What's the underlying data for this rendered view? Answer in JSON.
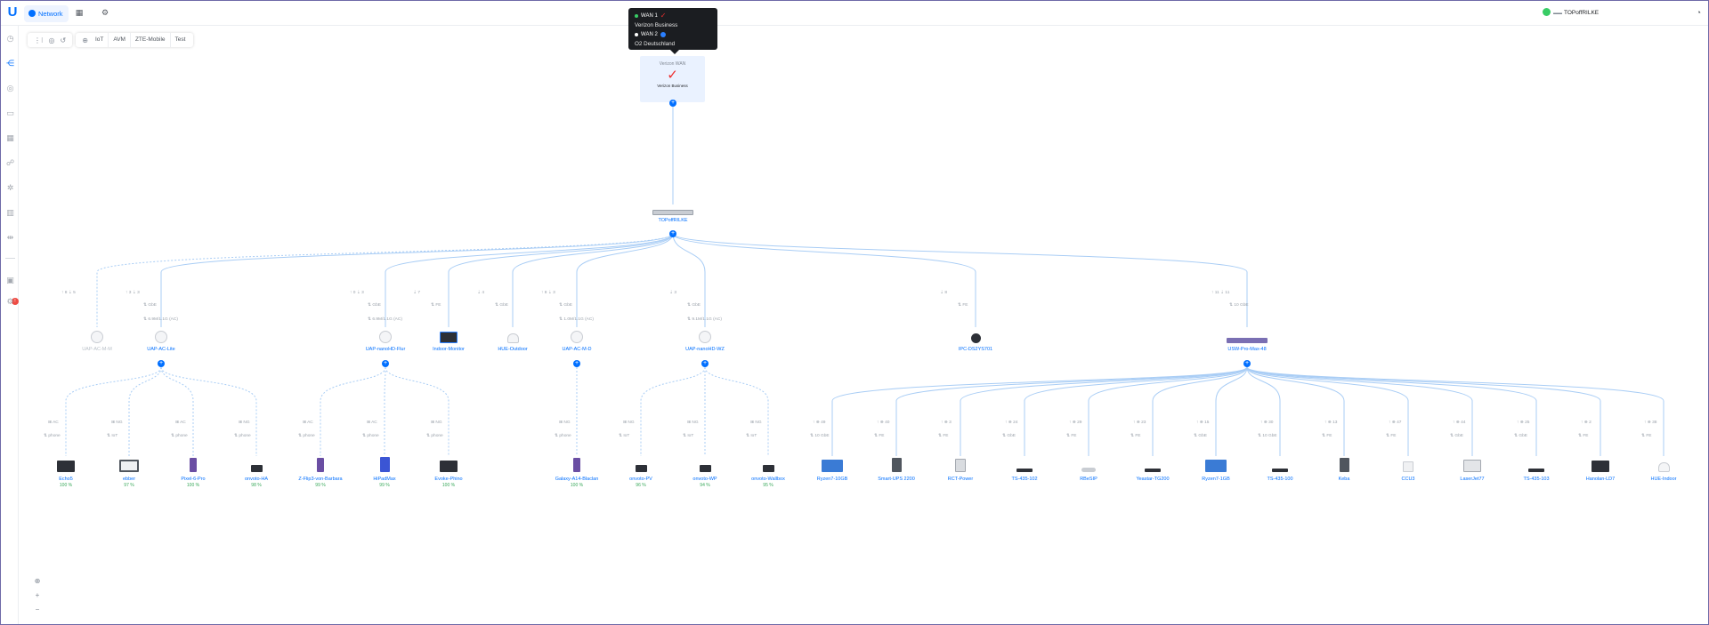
{
  "app": {
    "active_tab": "Network",
    "console_name": "TOPoffRILKE"
  },
  "colors": {
    "accent": "#006fff",
    "online": "#38cc65",
    "alert": "#ee4b43",
    "link": "#a9cdf5",
    "verizon": "#ee2d2d"
  },
  "toolbar": {
    "filters": [
      "IoT",
      "AVM",
      "ZTE-Mobile",
      "Test"
    ]
  },
  "wan_tooltip": {
    "rows": [
      {
        "name": "WAN 1",
        "isp": "Verizon Business",
        "status_color": "#38cc65"
      },
      {
        "name": "WAN 2",
        "isp": "O2 Deutschland",
        "status_color": "#ffffff"
      }
    ]
  },
  "wan_card": {
    "label": "Verizon WAN",
    "isp": "Verizon Business"
  },
  "gateway": {
    "name": "TOPoffRILKE"
  },
  "tier1": [
    {
      "name": "UAP-AC-M-M",
      "grey": true,
      "up": "8",
      "down": "5",
      "band": "",
      "rate": "",
      "icon": "ap"
    },
    {
      "name": "UAP-AC-Lite",
      "up": "3",
      "down": "3",
      "band": "GbE",
      "rate": "6.9M/1.1G (AC)",
      "icon": "ap"
    },
    {
      "name": "UAP-nanoHD-Flur",
      "up": "0",
      "down": "3",
      "band": "GbE",
      "rate": "6.9M/1.1G (AC)",
      "icon": "ap"
    },
    {
      "name": "Indoor-Monitor",
      "up": "",
      "down": "7",
      "band": "FE",
      "rate": "",
      "icon": "monitor"
    },
    {
      "name": "HUE-Outdoor",
      "up": "",
      "down": "4",
      "band": "GbE",
      "rate": "",
      "icon": "hub"
    },
    {
      "name": "UAP-AC-M-D",
      "up": "8",
      "down": "3",
      "band": "GbE",
      "rate": "1.0M/1.1G (AC)",
      "icon": "ap"
    },
    {
      "name": "UAP-nanoHD-WZ",
      "up": "",
      "down": "3",
      "band": "GbE",
      "rate": "9.1M/1.1G (AC)",
      "icon": "ap"
    },
    {
      "name": "IPC-DS2YS701",
      "up": "",
      "down": "8",
      "band": "FE",
      "rate": "",
      "icon": "camera"
    },
    {
      "name": "USW-Pro-Max-48",
      "up": "11",
      "down": "11",
      "band": "10 GbE",
      "rate": "",
      "icon": "switch"
    }
  ],
  "tier2": [
    {
      "name": "Echo5",
      "pct": "100 %",
      "band": "AC",
      "mode": "phone",
      "icon": "screen"
    },
    {
      "name": "ebber",
      "pct": "97 %",
      "band": "NG",
      "mode": "IoT",
      "icon": "tv"
    },
    {
      "name": "Pixel-6-Pro",
      "pct": "100 %",
      "band": "AC",
      "mode": "phone",
      "icon": "phone"
    },
    {
      "name": "onvoto-HA",
      "pct": "98 %",
      "band": "NG",
      "mode": "phone",
      "icon": "box"
    },
    {
      "name": "Z-Flip3-von-Barbara",
      "pct": "99 %",
      "band": "AC",
      "mode": "phone",
      "icon": "phone"
    },
    {
      "name": "HiPadMax",
      "pct": "99 %",
      "band": "AC",
      "mode": "phone",
      "icon": "tablet"
    },
    {
      "name": "Evoke-Phino",
      "pct": "100 %",
      "band": "NG",
      "mode": "phone",
      "icon": "screen"
    },
    {
      "name": "Galaxy-A14-Blaclan",
      "pct": "100 %",
      "band": "NG",
      "mode": "phone",
      "icon": "phone"
    },
    {
      "name": "onvoto-PV",
      "pct": "96 %",
      "band": "NG",
      "mode": "IoT",
      "icon": "box"
    },
    {
      "name": "onvoto-WP",
      "pct": "94 %",
      "band": "NG",
      "mode": "IoT",
      "icon": "box"
    },
    {
      "name": "onvoto-Wallbox",
      "pct": "95 %",
      "band": "NG",
      "mode": "IoT",
      "icon": "box"
    },
    {
      "name": "Ryzen7-10GB",
      "pct": "",
      "band": "49",
      "mode": "10 GbE",
      "icon": "pc"
    },
    {
      "name": "Smart-UPS 2200",
      "pct": "",
      "band": "40",
      "mode": "FE",
      "icon": "ups"
    },
    {
      "name": "RCT-Power",
      "pct": "",
      "band": "3",
      "mode": "FE",
      "icon": "inverter"
    },
    {
      "name": "TS-435-102",
      "pct": "",
      "band": "24",
      "mode": "GbE",
      "icon": "flat"
    },
    {
      "name": "RBeSIP",
      "pct": "",
      "band": "29",
      "mode": "FE",
      "icon": "flatlight"
    },
    {
      "name": "Yeastar-TG200",
      "pct": "",
      "band": "23",
      "mode": "FE",
      "icon": "flat"
    },
    {
      "name": "Ryzen7-1GB",
      "pct": "",
      "band": "15",
      "mode": "GbE",
      "icon": "pc"
    },
    {
      "name": "TS-435-100",
      "pct": "",
      "band": "30",
      "mode": "10 GbE",
      "icon": "flat"
    },
    {
      "name": "Keba",
      "pct": "",
      "band": "13",
      "mode": "FE",
      "icon": "ups"
    },
    {
      "name": "CCU3",
      "pct": "",
      "band": "47",
      "mode": "FE",
      "icon": "smallbox"
    },
    {
      "name": "LaserJet77",
      "pct": "",
      "band": "44",
      "mode": "GbE",
      "icon": "printer"
    },
    {
      "name": "TS-435-103",
      "pct": "",
      "band": "25",
      "mode": "GbE",
      "icon": "flat"
    },
    {
      "name": "Hanolan-LD7",
      "pct": "",
      "band": "2",
      "mode": "FE",
      "icon": "screen"
    },
    {
      "name": "HUE-Indoor",
      "pct": "",
      "band": "38",
      "mode": "FE",
      "icon": "hub"
    }
  ]
}
